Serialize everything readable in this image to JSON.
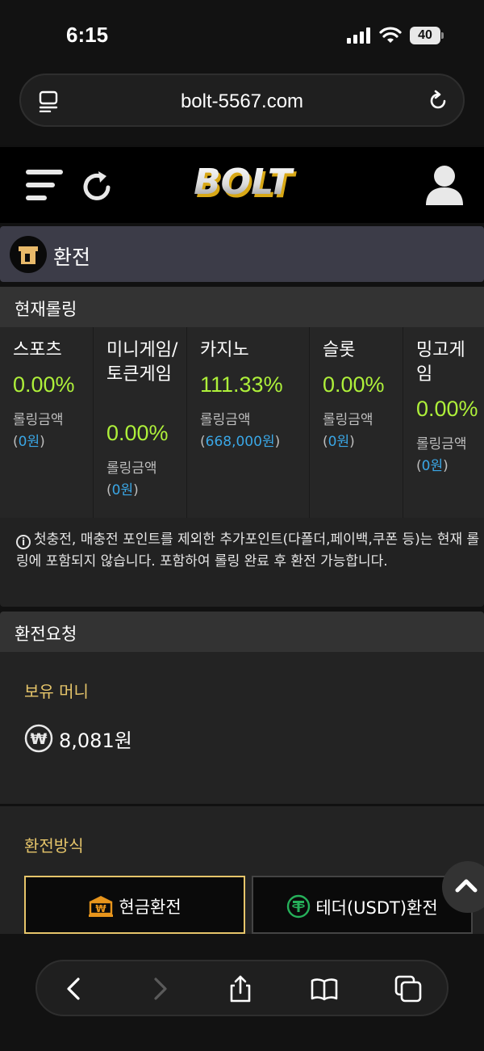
{
  "status_bar": {
    "time": "6:15",
    "battery": "40"
  },
  "browser": {
    "url": "bolt-5567.com"
  },
  "site": {
    "logo_text": "BOLT"
  },
  "page": {
    "title": "환전"
  },
  "rolling": {
    "title": "현재롤링",
    "columns": [
      {
        "name": "스포츠",
        "percent": "0.00%",
        "label": "롤링금액",
        "amount": "0원"
      },
      {
        "name": "미니게임/토큰게임",
        "percent": "0.00%",
        "label": "롤링금액",
        "amount": "0원"
      },
      {
        "name": "카지노",
        "percent": "111.33%",
        "label": "롤링금액",
        "amount": "668,000원"
      },
      {
        "name": "슬롯",
        "percent": "0.00%",
        "label": "롤링금액",
        "amount": "0원"
      },
      {
        "name": "밍고게임",
        "percent": "0.00%",
        "label": "롤링금액",
        "amount": "0원"
      }
    ],
    "notice": "첫충전, 매충전 포인트를 제외한 추가포인트(다폴더,페이백,쿠폰 등)는 현재 롤링에 포함되지 않습니다. 포함하여 롤링 완료 후 환전 가능합니다."
  },
  "request": {
    "title": "환전요청",
    "holdings_label": "보유 머니",
    "holdings_value": "8,081원",
    "method_label": "환전방식",
    "methods": [
      {
        "label": "현금환전",
        "selected": true
      },
      {
        "label": "테더(USDT)환전",
        "selected": false
      }
    ]
  },
  "colors": {
    "accent_green": "#aef03a",
    "accent_gold": "#e6c56a",
    "link_blue": "#3aa7e6"
  }
}
